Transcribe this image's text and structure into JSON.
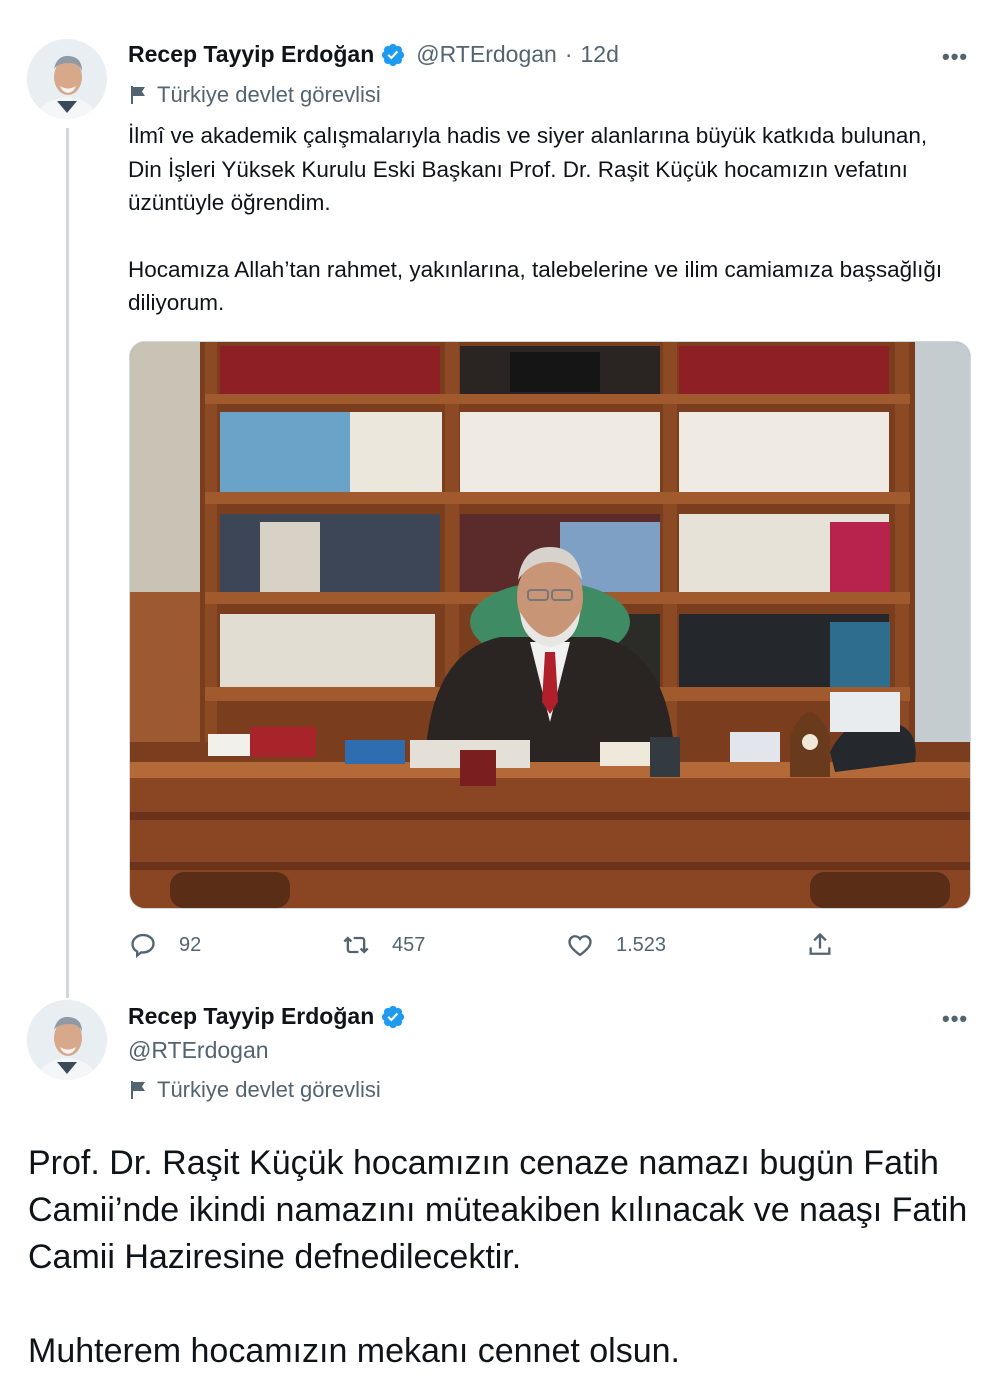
{
  "tweets": [
    {
      "author_name": "Recep Tayyip Erdoğan",
      "handle": "@RTErdogan",
      "separator": "·",
      "age": "12d",
      "label": "Türkiye devlet görevlisi",
      "paragraphs": [
        "İlmî ve akademik çalışmalarıyla hadis ve siyer alanlarına büyük katkıda bulunan, Din İşleri Yüksek Kurulu Eski Başkanı Prof. Dr. Raşit Küçük hocamızın vefatını üzüntüyle öğrendim.",
        "Hocamıza Allah’tan rahmet, yakınlarına, talebelerine ve ilim camiamıza başsağlığı diliyorum."
      ],
      "actions": {
        "reply_count": "92",
        "retweet_count": "457",
        "like_count": "1.523"
      },
      "more_label": "•••"
    },
    {
      "author_name": "Recep Tayyip Erdoğan",
      "handle": "@RTErdogan",
      "label": "Türkiye devlet görevlisi",
      "paragraphs": [
        "Prof. Dr. Raşit Küçük hocamızın cenaze namazı bugün Fatih Camii’nde ikindi namazını müteakiben kılınacak ve naaşı Fatih Camii Haziresine defnedilecektir.",
        "Muhterem hocamızın mekanı cennet olsun."
      ],
      "more_label": "•••"
    }
  ],
  "colors": {
    "text": "#0f1419",
    "secondary": "#536471",
    "verified": "#1d9bf0",
    "thread_line": "#cfd9de"
  },
  "icons": [
    "verified-badge-icon",
    "flag-icon",
    "reply-icon",
    "retweet-icon",
    "like-icon",
    "share-icon",
    "more-icon"
  ]
}
